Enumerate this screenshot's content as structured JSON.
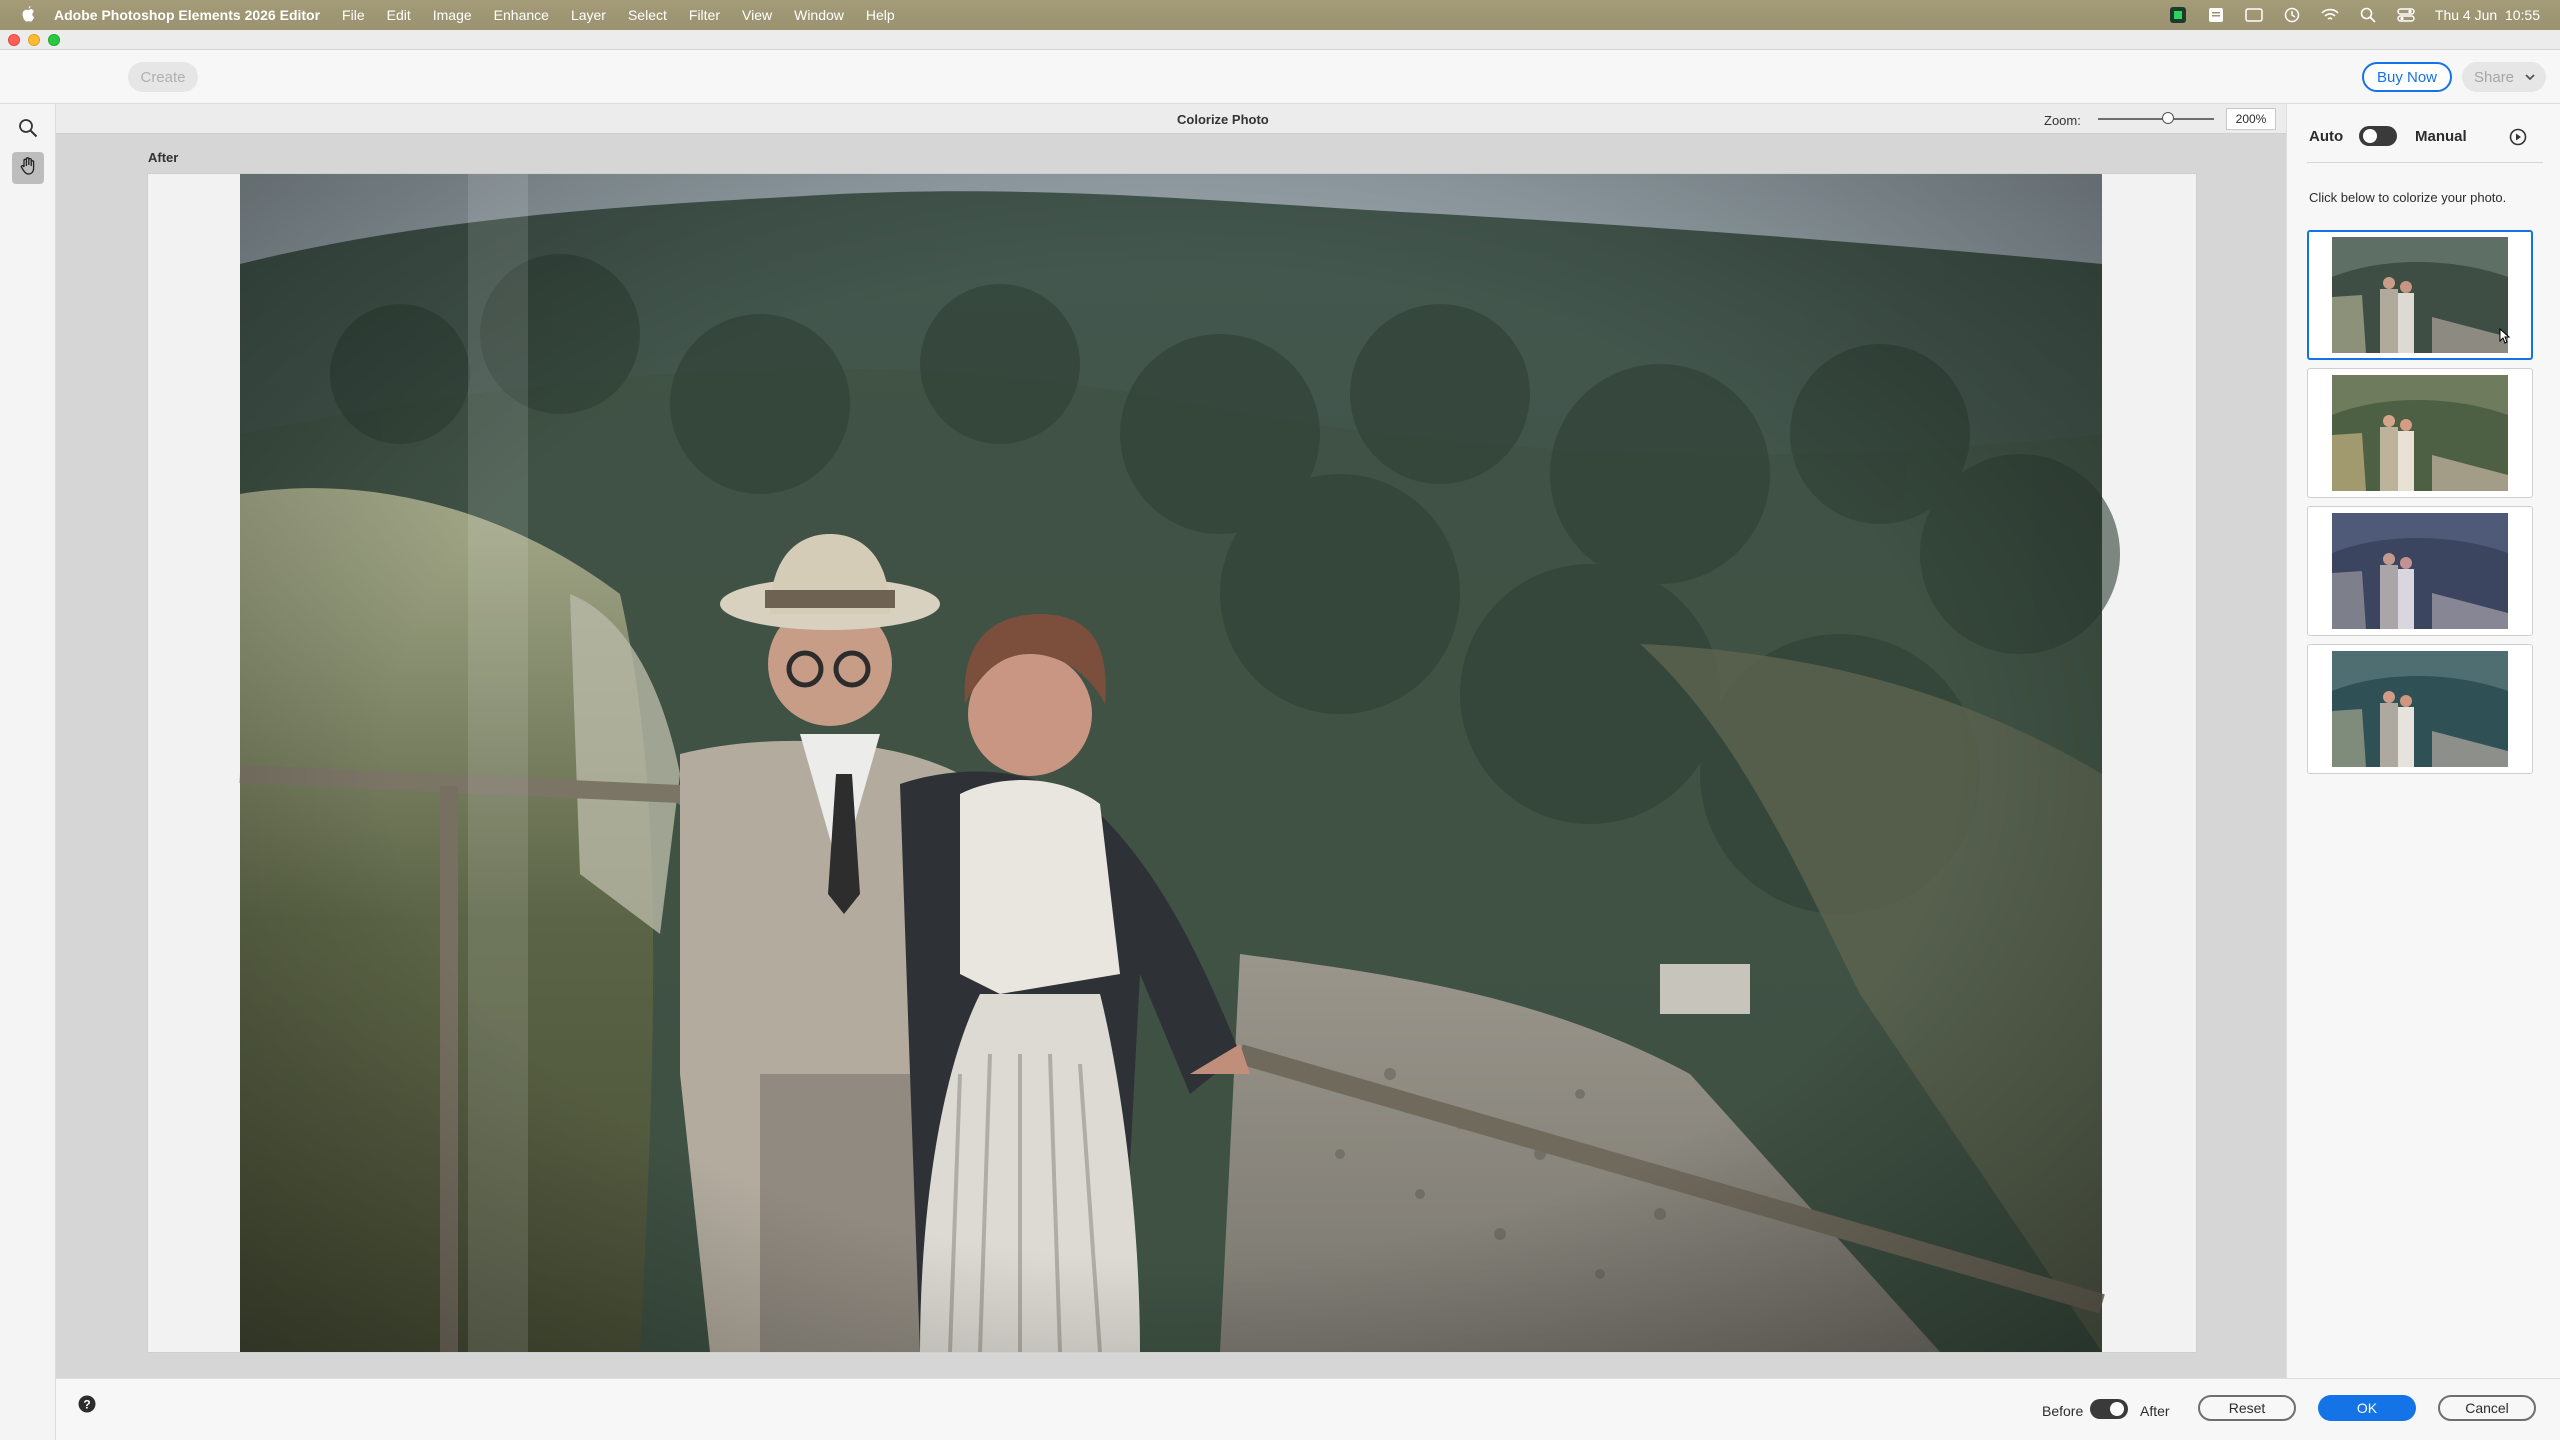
{
  "menubar": {
    "app_name": "Adobe Photoshop Elements 2026 Editor",
    "items": [
      "File",
      "Edit",
      "Image",
      "Enhance",
      "Layer",
      "Select",
      "Filter",
      "View",
      "Window",
      "Help"
    ],
    "clock": "Thu 4 Jun  10:55"
  },
  "header": {
    "create_label": "Create",
    "buy_label": "Buy Now",
    "share_label": "Share"
  },
  "canvas": {
    "title": "Colorize Photo",
    "view_label": "After",
    "zoom_label": "Zoom:",
    "zoom_value": "200%"
  },
  "panel": {
    "auto_label": "Auto",
    "manual_label": "Manual",
    "instruction": "Click below to colorize your photo."
  },
  "footer": {
    "before_label": "Before",
    "after_label": "After",
    "reset_label": "Reset",
    "ok_label": "OK",
    "cancel_label": "Cancel"
  },
  "colors": {
    "accent": "#1473e6",
    "menubar": "#a39b76"
  },
  "icons": [
    "apple-icon",
    "search-icon",
    "hand-icon",
    "help-icon",
    "play-icon",
    "chevron-down-icon",
    "wifi-icon",
    "control-center-icon"
  ]
}
